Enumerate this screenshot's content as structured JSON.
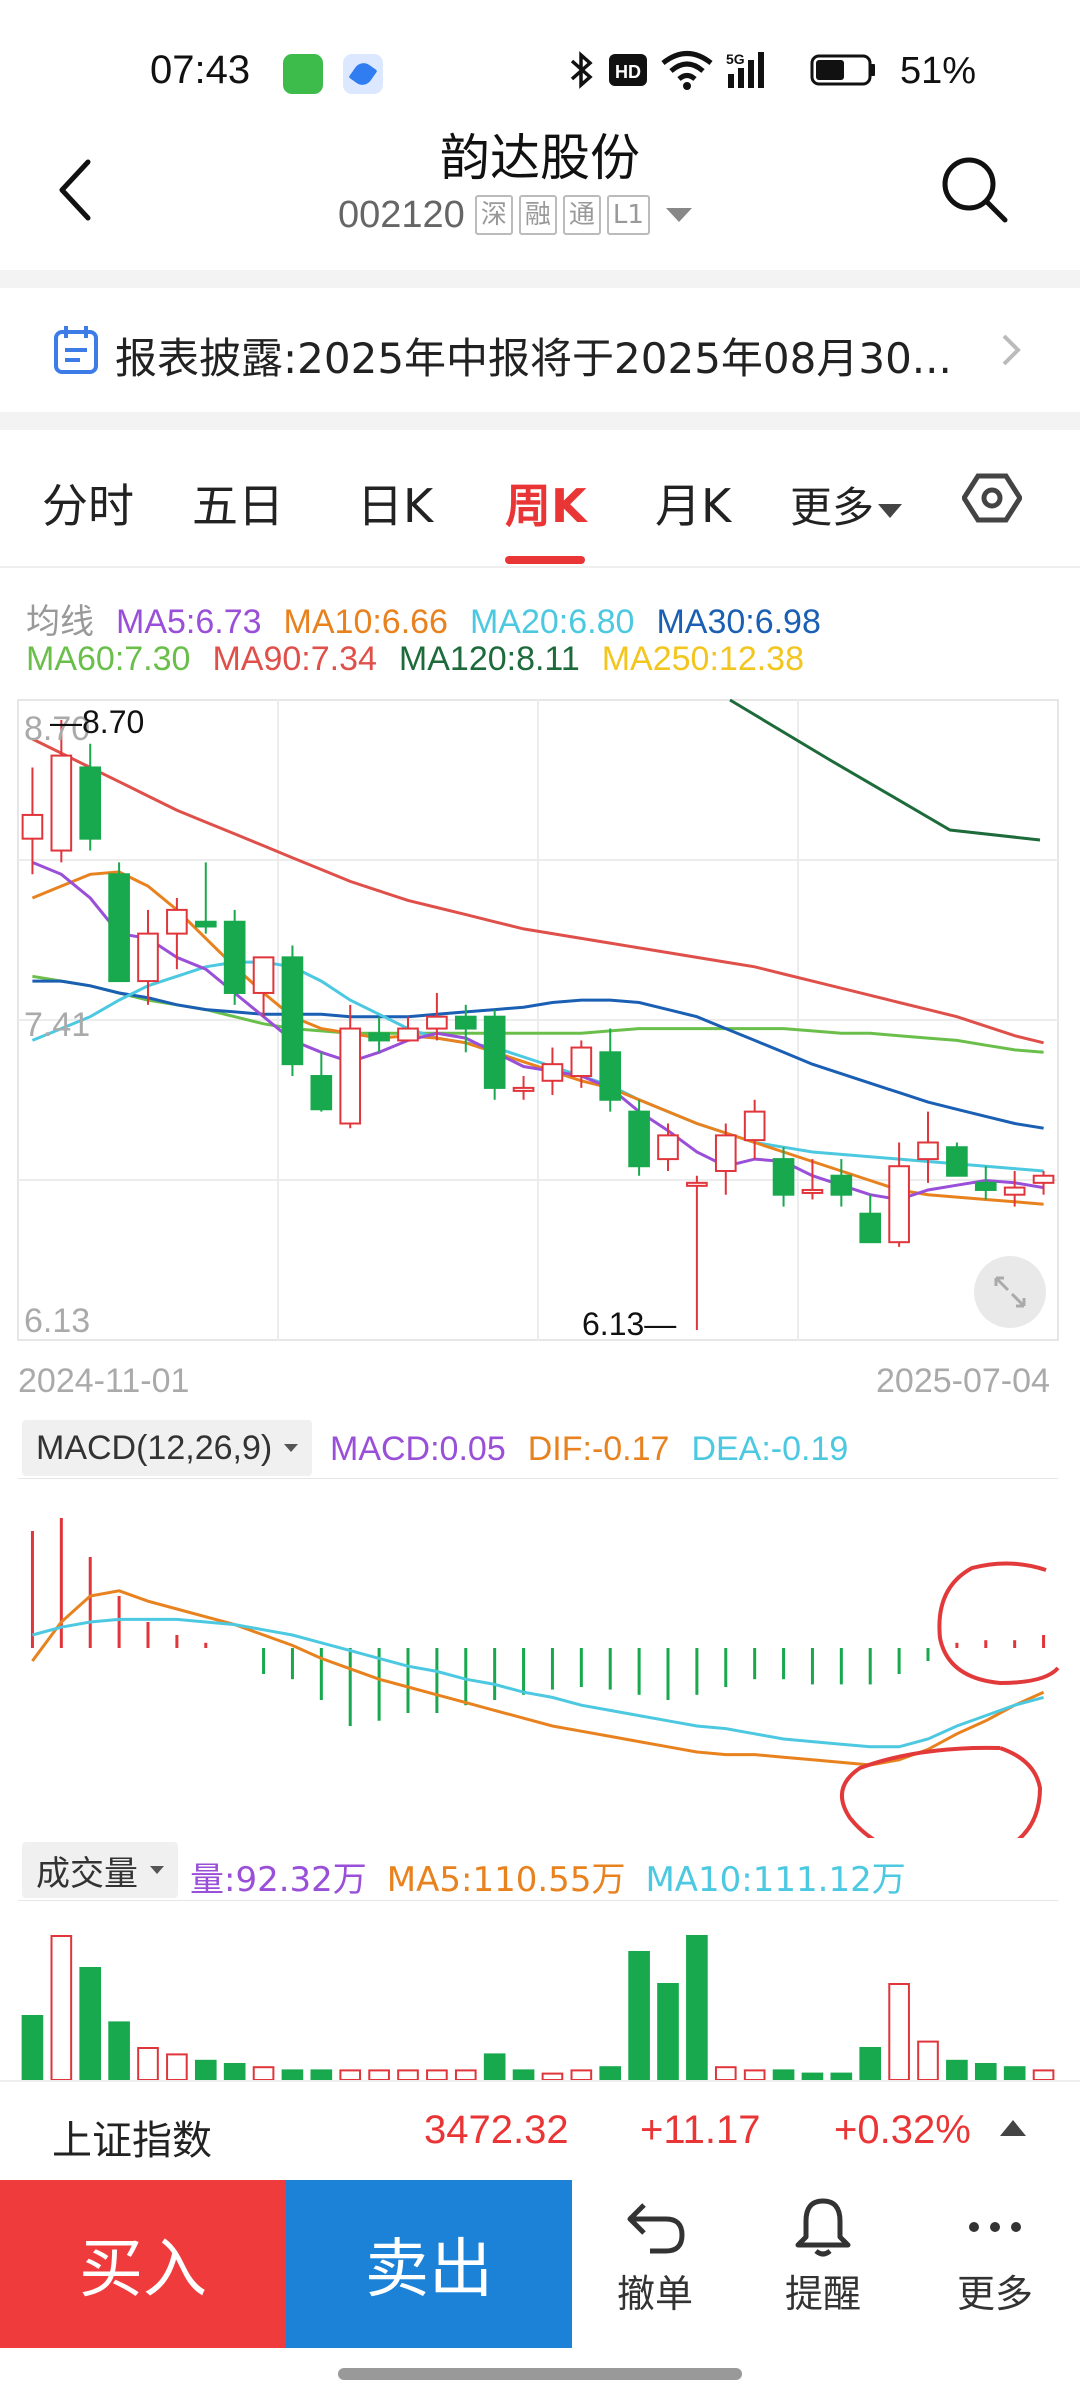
{
  "status_bar": {
    "time": "07:43",
    "battery": "51%",
    "icons": [
      "bluetooth-icon",
      "hd-icon",
      "wifi-icon",
      "5g-signal-icon",
      "battery-icon"
    ]
  },
  "header": {
    "title": "韵达股份",
    "code": "002120",
    "tags": [
      "深",
      "融",
      "通",
      "L1"
    ]
  },
  "notice": {
    "text": "报表披露:2025年中报将于2025年08月30..."
  },
  "tabs": {
    "items": [
      "分时",
      "五日",
      "日K",
      "周K",
      "月K",
      "更多"
    ],
    "active": "周K"
  },
  "ma_legend": {
    "label": "均线",
    "ma5": "MA5:6.73",
    "ma10": "MA10:6.66",
    "ma20": "MA20:6.80",
    "ma30": "MA30:6.98",
    "ma60": "MA60:7.30",
    "ma90": "MA90:7.34",
    "ma120": "MA120:8.11",
    "ma250": "MA250:12.38",
    "colors": {
      "ma5": "#9a4fd8",
      "ma10": "#e8821f",
      "ma20": "#4cc9e0",
      "ma30": "#1a5fb4",
      "ma60": "#6abf4b",
      "ma90": "#e0504a",
      "ma120": "#1d6b3a",
      "ma250": "#f2c51f"
    }
  },
  "kline": {
    "y_top_label": "8.70",
    "y_mid_label": "7.41",
    "y_bottom_label": "6.13",
    "high_marker": "8.70",
    "low_marker": "6.13",
    "date_start": "2024-11-01",
    "date_end": "2025-07-04"
  },
  "macd": {
    "selector": "MACD(12,26,9)",
    "macd": "MACD:0.05",
    "dif": "DIF:-0.17",
    "dea": "DEA:-0.19"
  },
  "volume": {
    "selector": "成交量",
    "vol": "量:92.32万",
    "ma5": "MA5:110.55万",
    "ma10": "MA10:111.12万"
  },
  "index_bar": {
    "name": "上证指数",
    "value": "3472.32",
    "change": "+11.17",
    "pct": "+0.32%"
  },
  "actions": {
    "buy": "买入",
    "sell": "卖出",
    "cancel": "撤单",
    "alert": "提醒",
    "more": "更多"
  },
  "chart_data": {
    "type": "candlestick",
    "period": "weekly",
    "x_range": [
      "2024-11-01",
      "2025-07-04"
    ],
    "ylim": [
      6.13,
      8.7
    ],
    "candles_ohlc": [
      [
        8.2,
        8.5,
        8.05,
        8.3
      ],
      [
        8.15,
        8.7,
        8.1,
        8.55
      ],
      [
        8.5,
        8.6,
        8.15,
        8.2
      ],
      [
        8.05,
        8.1,
        7.6,
        7.6
      ],
      [
        7.6,
        7.9,
        7.5,
        7.8
      ],
      [
        7.8,
        7.95,
        7.65,
        7.9
      ],
      [
        7.85,
        8.1,
        7.8,
        7.83
      ],
      [
        7.85,
        7.9,
        7.5,
        7.55
      ],
      [
        7.55,
        7.7,
        7.45,
        7.7
      ],
      [
        7.7,
        7.75,
        7.2,
        7.25
      ],
      [
        7.2,
        7.3,
        7.05,
        7.06
      ],
      [
        7.0,
        7.5,
        6.98,
        7.4
      ],
      [
        7.38,
        7.45,
        7.3,
        7.35
      ],
      [
        7.35,
        7.45,
        7.35,
        7.4
      ],
      [
        7.4,
        7.55,
        7.35,
        7.45
      ],
      [
        7.45,
        7.5,
        7.3,
        7.4
      ],
      [
        7.45,
        7.48,
        7.1,
        7.15
      ],
      [
        7.15,
        7.2,
        7.1,
        7.15
      ],
      [
        7.18,
        7.32,
        7.12,
        7.25
      ],
      [
        7.2,
        7.35,
        7.15,
        7.32
      ],
      [
        7.3,
        7.4,
        7.05,
        7.1
      ],
      [
        7.05,
        7.1,
        6.78,
        6.82
      ],
      [
        6.85,
        7.0,
        6.8,
        6.95
      ],
      [
        6.75,
        6.78,
        6.13,
        6.75
      ],
      [
        6.8,
        7.0,
        6.7,
        6.95
      ],
      [
        6.93,
        7.1,
        6.85,
        7.05
      ],
      [
        6.85,
        6.9,
        6.65,
        6.7
      ],
      [
        6.72,
        6.85,
        6.68,
        6.72
      ],
      [
        6.78,
        6.85,
        6.65,
        6.7
      ],
      [
        6.62,
        6.7,
        6.5,
        6.5
      ],
      [
        6.5,
        6.92,
        6.48,
        6.82
      ],
      [
        6.85,
        7.05,
        6.75,
        6.92
      ],
      [
        6.9,
        6.92,
        6.78,
        6.78
      ],
      [
        6.75,
        6.82,
        6.68,
        6.72
      ],
      [
        6.7,
        6.8,
        6.65,
        6.73
      ],
      [
        6.75,
        6.8,
        6.7,
        6.78
      ]
    ],
    "ma_lines": {
      "MA5": [
        8.1,
        8.05,
        7.95,
        7.8,
        7.78,
        7.7,
        7.65,
        7.55,
        7.45,
        7.35,
        7.3,
        7.26,
        7.3,
        7.35,
        7.38,
        7.36,
        7.3,
        7.24,
        7.22,
        7.2,
        7.15,
        7.05,
        6.97,
        6.88,
        6.82,
        6.85,
        6.84,
        6.78,
        6.74,
        6.7,
        6.68,
        6.72,
        6.74,
        6.76,
        6.75,
        6.73
      ],
      "MA10": [
        7.95,
        8.0,
        8.05,
        8.06,
        8.0,
        7.9,
        7.78,
        7.66,
        7.55,
        7.45,
        7.4,
        7.38,
        7.36,
        7.37,
        7.36,
        7.34,
        7.3,
        7.26,
        7.22,
        7.18,
        7.15,
        7.1,
        7.05,
        7.0,
        6.96,
        6.92,
        6.88,
        6.84,
        6.8,
        6.76,
        6.72,
        6.7,
        6.69,
        6.68,
        6.67,
        6.66
      ],
      "MA20": [
        7.35,
        7.4,
        7.45,
        7.52,
        7.58,
        7.62,
        7.66,
        7.68,
        7.68,
        7.66,
        7.6,
        7.52,
        7.46,
        7.4,
        7.36,
        7.34,
        7.32,
        7.28,
        7.24,
        7.2,
        7.16,
        7.1,
        7.05,
        7.0,
        6.96,
        6.92,
        6.9,
        6.88,
        6.87,
        6.86,
        6.85,
        6.84,
        6.83,
        6.82,
        6.81,
        6.8
      ],
      "MA30": [
        7.6,
        7.6,
        7.58,
        7.55,
        7.53,
        7.5,
        7.48,
        7.47,
        7.46,
        7.46,
        7.46,
        7.45,
        7.45,
        7.45,
        7.46,
        7.47,
        7.48,
        7.49,
        7.51,
        7.52,
        7.52,
        7.51,
        7.48,
        7.45,
        7.4,
        7.35,
        7.3,
        7.25,
        7.21,
        7.17,
        7.13,
        7.09,
        7.06,
        7.03,
        7.0,
        6.98
      ],
      "MA60": [
        7.62,
        7.6,
        7.58,
        7.55,
        7.52,
        7.5,
        7.48,
        7.45,
        7.42,
        7.4,
        7.39,
        7.38,
        7.38,
        7.38,
        7.38,
        7.38,
        7.38,
        7.38,
        7.38,
        7.38,
        7.39,
        7.4,
        7.4,
        7.4,
        7.4,
        7.4,
        7.4,
        7.39,
        7.38,
        7.38,
        7.37,
        7.36,
        7.35,
        7.33,
        7.31,
        7.3
      ],
      "MA90": [
        8.62,
        8.56,
        8.5,
        8.44,
        8.38,
        8.32,
        8.27,
        8.22,
        8.17,
        8.12,
        8.07,
        8.02,
        7.98,
        7.94,
        7.91,
        7.88,
        7.85,
        7.82,
        7.8,
        7.78,
        7.76,
        7.74,
        7.72,
        7.7,
        7.68,
        7.66,
        7.63,
        7.6,
        7.57,
        7.54,
        7.51,
        7.48,
        7.45,
        7.41,
        7.37,
        7.34
      ]
    },
    "macd_dif": [
      -0.05,
      0.1,
      0.2,
      0.22,
      0.18,
      0.15,
      0.12,
      0.09,
      0.05,
      0.01,
      -0.04,
      -0.08,
      -0.12,
      -0.15,
      -0.18,
      -0.21,
      -0.24,
      -0.27,
      -0.3,
      -0.32,
      -0.34,
      -0.36,
      -0.38,
      -0.4,
      -0.41,
      -0.41,
      -0.42,
      -0.43,
      -0.44,
      -0.45,
      -0.43,
      -0.39,
      -0.33,
      -0.28,
      -0.22,
      -0.17
    ],
    "macd_dea": [
      0.05,
      0.08,
      0.1,
      0.11,
      0.11,
      0.11,
      0.1,
      0.09,
      0.07,
      0.05,
      0.02,
      -0.01,
      -0.04,
      -0.07,
      -0.09,
      -0.12,
      -0.14,
      -0.17,
      -0.19,
      -0.22,
      -0.24,
      -0.26,
      -0.28,
      -0.3,
      -0.31,
      -0.33,
      -0.35,
      -0.36,
      -0.37,
      -0.38,
      -0.38,
      -0.35,
      -0.3,
      -0.26,
      -0.22,
      -0.19
    ],
    "macd_hist": [
      0.45,
      0.5,
      0.35,
      0.2,
      0.1,
      0.05,
      0.02,
      0.0,
      -0.1,
      -0.12,
      -0.2,
      -0.3,
      -0.28,
      -0.25,
      -0.25,
      -0.22,
      -0.2,
      -0.18,
      -0.16,
      -0.15,
      -0.16,
      -0.18,
      -0.2,
      -0.18,
      -0.15,
      -0.12,
      -0.12,
      -0.14,
      -0.14,
      -0.14,
      -0.1,
      -0.05,
      0.02,
      0.03,
      0.03,
      0.05
    ],
    "volume": [
      20,
      45,
      35,
      18,
      10,
      8,
      6,
      5,
      4,
      3,
      3,
      3,
      3,
      3,
      3,
      3,
      8,
      3,
      2,
      3,
      4,
      40,
      30,
      45,
      4,
      3,
      3,
      2,
      2,
      10,
      30,
      12,
      6,
      5,
      4,
      3
    ],
    "volume_up": [
      false,
      true,
      false,
      false,
      true,
      true,
      false,
      false,
      true,
      false,
      false,
      true,
      true,
      true,
      true,
      true,
      false,
      false,
      true,
      true,
      false,
      false,
      false,
      false,
      true,
      true,
      false,
      false,
      false,
      false,
      true,
      true,
      false,
      false,
      false,
      true
    ]
  }
}
